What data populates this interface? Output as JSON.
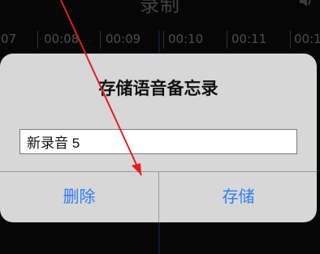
{
  "nav": {
    "title": "录制"
  },
  "timeline": {
    "ticks": [
      {
        "label": ":07"
      },
      {
        "label": "00:08"
      },
      {
        "label": "00:09"
      },
      {
        "label": "00:10"
      },
      {
        "label": "00:11"
      },
      {
        "label": "00:1"
      }
    ]
  },
  "alert": {
    "title": "存储语音备忘录",
    "input_value": "新录音 5",
    "buttons": {
      "delete_label": "删除",
      "save_label": "存储"
    }
  },
  "colors": {
    "accent": "#2f7ff2",
    "annotation_arrow": "#e02020",
    "alert_background": "#d7d7d7"
  },
  "icons": {
    "speaker": "speaker-icon",
    "arrow": "arrow-annotation-icon"
  }
}
